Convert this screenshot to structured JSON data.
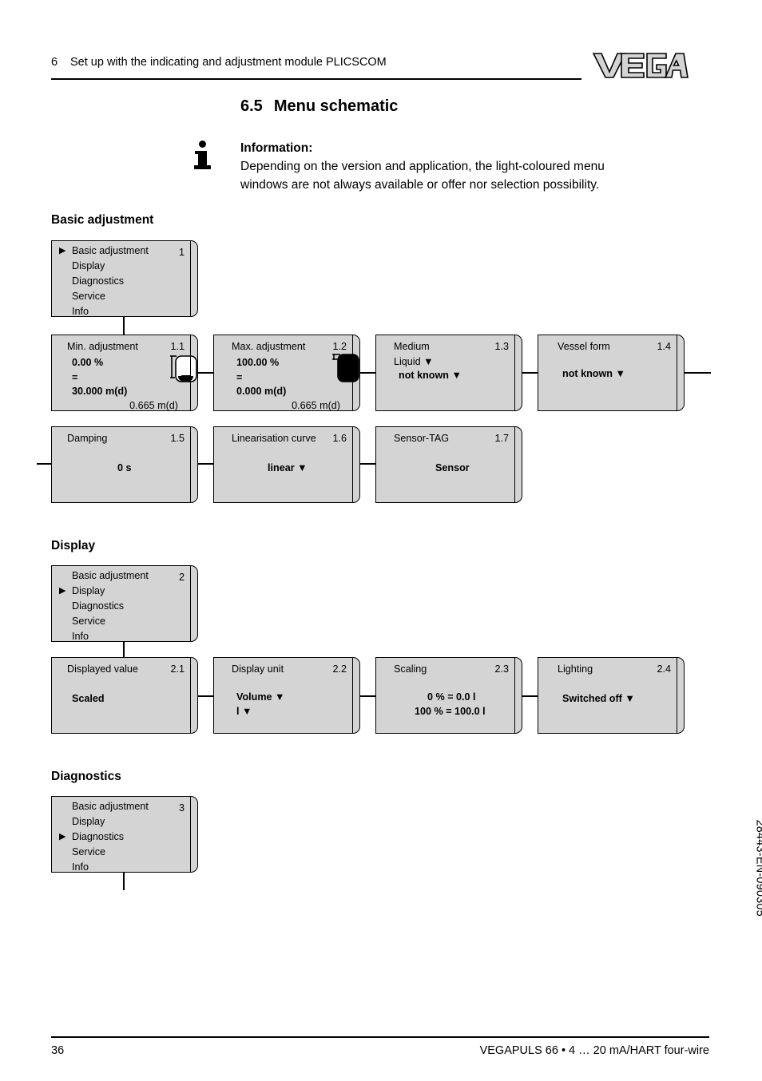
{
  "header": {
    "chapter_number": "6",
    "chapter_title": "Set up with the indicating and adjustment module PLICSCOM",
    "logo_text": "VEGA"
  },
  "section": {
    "number": "6.5",
    "title": "Menu schematic"
  },
  "information": {
    "icon": "info-icon",
    "title": "Information:",
    "line1": "Depending on the version and application, the light-coloured menu",
    "line2": "windows are not always available or offer nor selection possibility."
  },
  "groups": {
    "basic_adjustment": "Basic adjustment",
    "display": "Display",
    "diagnostics": "Diagnostics"
  },
  "menu_list_1": {
    "number": "1",
    "selected_index": 0,
    "items": [
      "Basic adjustment",
      "Display",
      "Diagnostics",
      "Service",
      "Info"
    ]
  },
  "menu_list_2": {
    "number": "2",
    "selected_index": 1,
    "items": [
      "Basic adjustment",
      "Display",
      "Diagnostics",
      "Service",
      "Info"
    ]
  },
  "menu_list_3": {
    "number": "3",
    "selected_index": 2,
    "items": [
      "Basic adjustment",
      "Display",
      "Diagnostics",
      "Service",
      "Info"
    ]
  },
  "boxes": {
    "b11": {
      "title": "Min. adjustment",
      "number": "1.1",
      "row1": "0.00 %",
      "row2": "=",
      "row3": "30.000 m(d)",
      "row4": "0.665 m(d)",
      "icon": "vessel-empty-icon"
    },
    "b12": {
      "title": "Max. adjustment",
      "number": "1.2",
      "row1": "100.00 %",
      "row2": "=",
      "row3": "0.000 m(d)",
      "row4": "0.665 m(d)",
      "icon": "vessel-full-icon"
    },
    "b13": {
      "title": "Medium",
      "number": "1.3",
      "row1": "Liquid ▼",
      "row2": "not known ▼"
    },
    "b14": {
      "title": "Vessel form",
      "number": "1.4",
      "row1": "not known ▼"
    },
    "b15": {
      "title": "Damping",
      "number": "1.5",
      "row1": "0 s"
    },
    "b16": {
      "title": "Linearisation curve",
      "number": "1.6",
      "row1": "linear ▼"
    },
    "b17": {
      "title": "Sensor-TAG",
      "number": "1.7",
      "row1": "Sensor"
    },
    "b21": {
      "title": "Displayed value",
      "number": "2.1",
      "row1": "Scaled"
    },
    "b22": {
      "title": "Display unit",
      "number": "2.2",
      "row1": "Volume ▼",
      "row2": "l ▼"
    },
    "b23": {
      "title": "Scaling",
      "number": "2.3",
      "row1": "0 % = 0.0 l",
      "row2": "100 % = 100.0 l"
    },
    "b24": {
      "title": "Lighting",
      "number": "2.4",
      "row1": "Switched off ▼"
    }
  },
  "footer": {
    "page_number": "36",
    "product": "VEGAPULS 66 • 4 … 20 mA/HART four-wire",
    "document_code": "28443-EN-090305"
  },
  "colors": {
    "box_fill": "#d4d4d4",
    "logo_fill": "#d4d4d4",
    "line": "#000000"
  }
}
